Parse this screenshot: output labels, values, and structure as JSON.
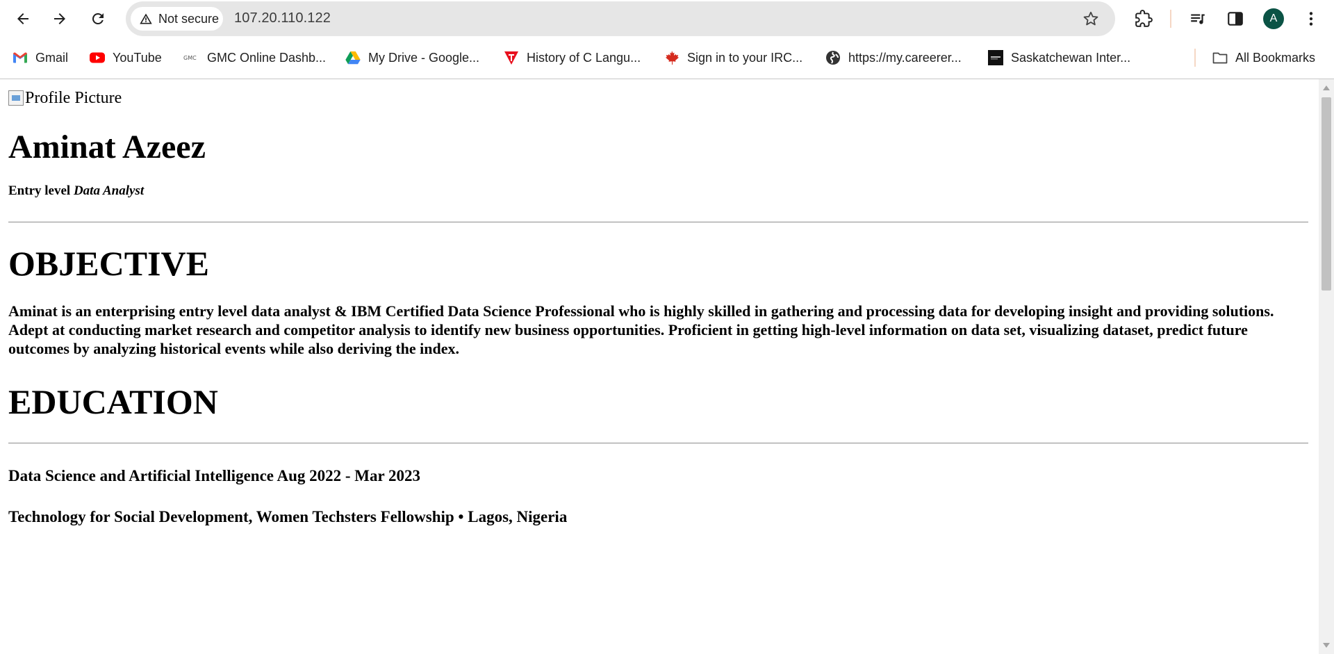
{
  "browser": {
    "security_label": "Not secure",
    "url": "107.20.110.122",
    "avatar_initial": "A",
    "avatar_color": "#0b5345"
  },
  "bookmarks": {
    "items": [
      {
        "label": "Gmail",
        "icon": "gmail-icon"
      },
      {
        "label": "YouTube",
        "icon": "youtube-icon"
      },
      {
        "label": "GMC Online Dashb...",
        "icon": "gmc-icon"
      },
      {
        "label": "My Drive - Google...",
        "icon": "google-drive-icon"
      },
      {
        "label": "History of C Langu...",
        "icon": "tutorial-icon"
      },
      {
        "label": "Sign in to your IRC...",
        "icon": "maple-leaf-icon"
      },
      {
        "label": "https://my.careerer...",
        "icon": "globe-icon"
      },
      {
        "label": "Saskatchewan Inter...",
        "icon": "site-icon"
      }
    ],
    "all_bookmarks_label": "All Bookmarks"
  },
  "page": {
    "profile_alt": "Profile Picture",
    "name": "Aminat Azeez",
    "subtitle_prefix": "Entry level",
    "subtitle_role": "Data Analyst",
    "objective_heading": "OBJECTIVE",
    "objective_text": "Aminat is an enterprising entry level data analyst & IBM Certified Data Science Professional who is highly skilled in gathering and processing data for developing insight and providing solutions. Adept at conducting market research and competitor analysis to identify new business opportunities. Proficient in getting high-level information on data set, visualizing dataset, predict future outcomes by analyzing historical events while also deriving the index.",
    "education_heading": "EDUCATION",
    "education": [
      {
        "line": "Data Science and Artificial Intelligence Aug 2022 - Mar 2023"
      },
      {
        "line": "Technology for Social Development, Women Techsters Fellowship • Lagos, Nigeria"
      }
    ]
  }
}
